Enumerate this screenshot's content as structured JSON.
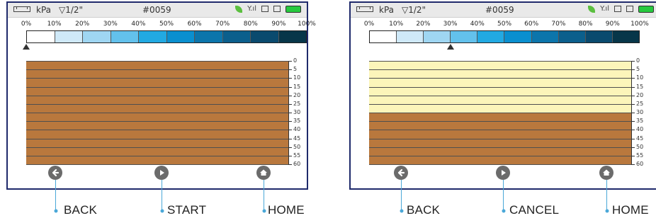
{
  "colors": {
    "scale": [
      "#ffffff",
      "#cfe9f8",
      "#9fd6f2",
      "#63c1ec",
      "#22a9e2",
      "#0a8fcf",
      "#0c75ab",
      "#0b5f8c",
      "#0a4a6e",
      "#073649"
    ],
    "soil": "#b9783d",
    "unfrozen": "#fcf5ba",
    "frame": "#1f2a6b",
    "callout": "#4aa8d8"
  },
  "screens": [
    {
      "status": {
        "units": "kPa",
        "filter": "▽1/2\"",
        "id": "#0059"
      },
      "scale": {
        "labels": [
          "0%",
          "10%",
          "20%",
          "30%",
          "40%",
          "50%",
          "60%",
          "70%",
          "80%",
          "90%",
          "100%"
        ],
        "marker_percent": 0
      },
      "depth_ticks": [
        "0",
        "5",
        "10",
        "15",
        "20",
        "25",
        "30",
        "35",
        "40",
        "45",
        "50",
        "55",
        "60"
      ],
      "profile": {
        "light_layer_end_depth": 0
      },
      "buttons": [
        {
          "icon": "back-arrow-icon",
          "label": "BACK"
        },
        {
          "icon": "play-icon",
          "label": "START"
        },
        {
          "icon": "home-icon",
          "label": "HOME"
        }
      ]
    },
    {
      "status": {
        "units": "kPa",
        "filter": "▽1/2\"",
        "id": "#0059"
      },
      "scale": {
        "labels": [
          "0%",
          "10%",
          "20%",
          "30%",
          "40%",
          "50%",
          "60%",
          "70%",
          "80%",
          "90%",
          "100%"
        ],
        "marker_percent": 30
      },
      "depth_ticks": [
        "0",
        "5",
        "10",
        "15",
        "20",
        "25",
        "30",
        "35",
        "40",
        "45",
        "50",
        "55",
        "60"
      ],
      "profile": {
        "light_layer_end_depth": 30
      },
      "buttons": [
        {
          "icon": "back-arrow-icon",
          "label": "BACK"
        },
        {
          "icon": "play-icon",
          "label": "CANCEL"
        },
        {
          "icon": "home-icon",
          "label": "HOME"
        }
      ]
    }
  ]
}
